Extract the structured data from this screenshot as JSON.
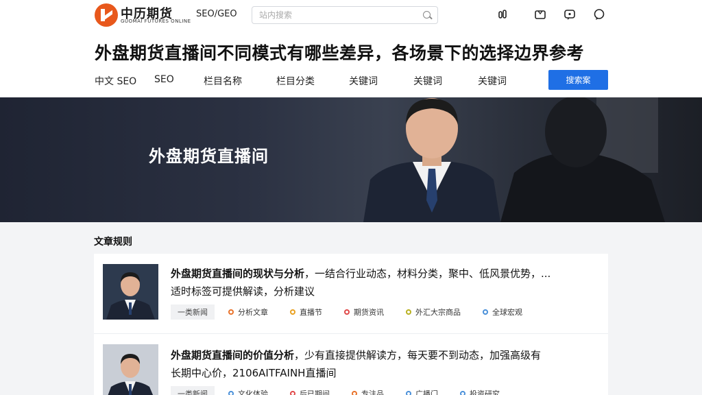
{
  "header": {
    "brand_name": "中历期货",
    "brand_sub": "GUOMAI FUTURES ONLINE",
    "nav_label": "SEO/GEO",
    "search_placeholder": "站内搜索",
    "icons": [
      "chart-icon",
      "tv-icon",
      "message-icon",
      "chat-icon"
    ]
  },
  "page": {
    "title": "外盘期货直播间不同模式有哪些差异，各场景下的选择边界参考"
  },
  "menu": {
    "items": [
      "中文 SEO",
      "SEO",
      "栏目名称",
      "栏目分类",
      "关键词",
      "关键词",
      "关键词"
    ],
    "button_label": "搜索案"
  },
  "banner": {
    "title": "外盘期货直播间"
  },
  "articles": {
    "section_title": "文章规则",
    "items": [
      {
        "title_bold": "外盘期货直播间的现状与分析",
        "title_rest": "，一结合行业动态，材料分类，聚中、低风景优势，...",
        "title_line2": "适时标签可提供解读，分析建议",
        "category": "一类新闻",
        "tags": [
          {
            "label": "分析文章",
            "color": "#e8722a"
          },
          {
            "label": "直播节",
            "color": "#e8a020"
          },
          {
            "label": "期货资讯",
            "color": "#e04848"
          },
          {
            "label": "外汇大宗商品",
            "color": "#b8b020"
          },
          {
            "label": "全球宏观",
            "color": "#4a90d9"
          }
        ]
      },
      {
        "title_bold": "外盘期货直播间的价值分析",
        "title_rest": "，少有直接提供解读方，每天要不到动态，加强高级有",
        "title_line2": "长期中心价，2106AITFAINH直播间",
        "category": "一类新闻",
        "tags": [
          {
            "label": "文化体验",
            "color": "#4a90d9"
          },
          {
            "label": "后已期间",
            "color": "#e04848"
          },
          {
            "label": "专注品",
            "color": "#e8722a"
          },
          {
            "label": "广播门",
            "color": "#4a90d9"
          },
          {
            "label": "投资研究",
            "color": "#4a90d9"
          }
        ]
      }
    ]
  }
}
